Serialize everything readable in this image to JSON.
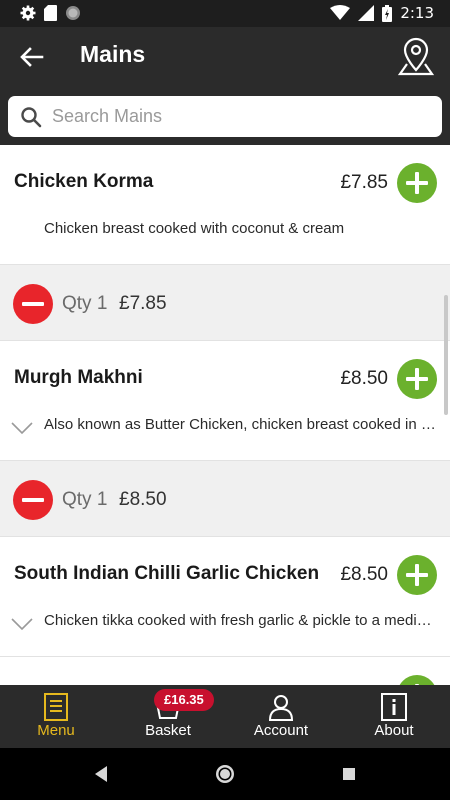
{
  "status_bar": {
    "time": "2:13"
  },
  "header": {
    "title": "Mains"
  },
  "search": {
    "placeholder": "Search Mains",
    "value": ""
  },
  "items": [
    {
      "name": "Chicken Korma",
      "price": "£7.85",
      "description": "Chicken breast cooked with coconut & cream",
      "expandable": false,
      "basket": {
        "qty_label": "Qty 1",
        "price": "£7.85"
      }
    },
    {
      "name": "Murgh Makhni",
      "price": "£8.50",
      "description": "Also known as Butter Chicken, chicken breast cooked in a creamy sauce",
      "expandable": true,
      "basket": {
        "qty_label": "Qty 1",
        "price": "£8.50"
      }
    },
    {
      "name": "South Indian Chilli Garlic Chicken",
      "price": "£8.50",
      "description": "Chicken tikka cooked with fresh garlic & pickle to a medium sauce",
      "expandable": true,
      "basket": null
    }
  ],
  "bottom_nav": {
    "menu_label": "Menu",
    "basket_label": "Basket",
    "basket_total": "£16.35",
    "account_label": "Account",
    "about_label": "About"
  },
  "colors": {
    "bar_background": "#2b2b2b",
    "add_button": "#6bb12d",
    "remove_button": "#e8252b",
    "active_nav": "#e6b91e",
    "badge": "#c8102e"
  },
  "icons": [
    "settings-icon",
    "sd-card-icon",
    "sync-icon",
    "wifi-icon",
    "signal-icon",
    "battery-icon",
    "back-arrow-icon",
    "location-pin-icon",
    "search-icon",
    "plus-icon",
    "minus-icon",
    "chevron-down-icon",
    "menu-list-icon",
    "basket-icon",
    "account-icon",
    "info-icon"
  ]
}
